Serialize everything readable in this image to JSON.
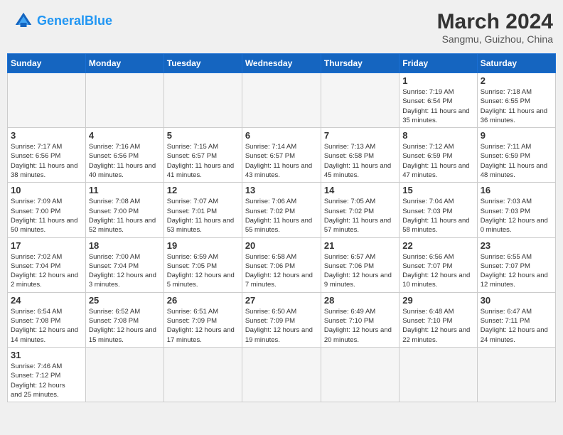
{
  "header": {
    "logo_general": "General",
    "logo_blue": "Blue",
    "month_year": "March 2024",
    "location": "Sangmu, Guizhou, China"
  },
  "weekdays": [
    "Sunday",
    "Monday",
    "Tuesday",
    "Wednesday",
    "Thursday",
    "Friday",
    "Saturday"
  ],
  "weeks": [
    [
      {
        "day": "",
        "info": ""
      },
      {
        "day": "",
        "info": ""
      },
      {
        "day": "",
        "info": ""
      },
      {
        "day": "",
        "info": ""
      },
      {
        "day": "",
        "info": ""
      },
      {
        "day": "1",
        "info": "Sunrise: 7:19 AM\nSunset: 6:54 PM\nDaylight: 11 hours and 35 minutes."
      },
      {
        "day": "2",
        "info": "Sunrise: 7:18 AM\nSunset: 6:55 PM\nDaylight: 11 hours and 36 minutes."
      }
    ],
    [
      {
        "day": "3",
        "info": "Sunrise: 7:17 AM\nSunset: 6:56 PM\nDaylight: 11 hours and 38 minutes."
      },
      {
        "day": "4",
        "info": "Sunrise: 7:16 AM\nSunset: 6:56 PM\nDaylight: 11 hours and 40 minutes."
      },
      {
        "day": "5",
        "info": "Sunrise: 7:15 AM\nSunset: 6:57 PM\nDaylight: 11 hours and 41 minutes."
      },
      {
        "day": "6",
        "info": "Sunrise: 7:14 AM\nSunset: 6:57 PM\nDaylight: 11 hours and 43 minutes."
      },
      {
        "day": "7",
        "info": "Sunrise: 7:13 AM\nSunset: 6:58 PM\nDaylight: 11 hours and 45 minutes."
      },
      {
        "day": "8",
        "info": "Sunrise: 7:12 AM\nSunset: 6:59 PM\nDaylight: 11 hours and 47 minutes."
      },
      {
        "day": "9",
        "info": "Sunrise: 7:11 AM\nSunset: 6:59 PM\nDaylight: 11 hours and 48 minutes."
      }
    ],
    [
      {
        "day": "10",
        "info": "Sunrise: 7:09 AM\nSunset: 7:00 PM\nDaylight: 11 hours and 50 minutes."
      },
      {
        "day": "11",
        "info": "Sunrise: 7:08 AM\nSunset: 7:00 PM\nDaylight: 11 hours and 52 minutes."
      },
      {
        "day": "12",
        "info": "Sunrise: 7:07 AM\nSunset: 7:01 PM\nDaylight: 11 hours and 53 minutes."
      },
      {
        "day": "13",
        "info": "Sunrise: 7:06 AM\nSunset: 7:02 PM\nDaylight: 11 hours and 55 minutes."
      },
      {
        "day": "14",
        "info": "Sunrise: 7:05 AM\nSunset: 7:02 PM\nDaylight: 11 hours and 57 minutes."
      },
      {
        "day": "15",
        "info": "Sunrise: 7:04 AM\nSunset: 7:03 PM\nDaylight: 11 hours and 58 minutes."
      },
      {
        "day": "16",
        "info": "Sunrise: 7:03 AM\nSunset: 7:03 PM\nDaylight: 12 hours and 0 minutes."
      }
    ],
    [
      {
        "day": "17",
        "info": "Sunrise: 7:02 AM\nSunset: 7:04 PM\nDaylight: 12 hours and 2 minutes."
      },
      {
        "day": "18",
        "info": "Sunrise: 7:00 AM\nSunset: 7:04 PM\nDaylight: 12 hours and 3 minutes."
      },
      {
        "day": "19",
        "info": "Sunrise: 6:59 AM\nSunset: 7:05 PM\nDaylight: 12 hours and 5 minutes."
      },
      {
        "day": "20",
        "info": "Sunrise: 6:58 AM\nSunset: 7:06 PM\nDaylight: 12 hours and 7 minutes."
      },
      {
        "day": "21",
        "info": "Sunrise: 6:57 AM\nSunset: 7:06 PM\nDaylight: 12 hours and 9 minutes."
      },
      {
        "day": "22",
        "info": "Sunrise: 6:56 AM\nSunset: 7:07 PM\nDaylight: 12 hours and 10 minutes."
      },
      {
        "day": "23",
        "info": "Sunrise: 6:55 AM\nSunset: 7:07 PM\nDaylight: 12 hours and 12 minutes."
      }
    ],
    [
      {
        "day": "24",
        "info": "Sunrise: 6:54 AM\nSunset: 7:08 PM\nDaylight: 12 hours and 14 minutes."
      },
      {
        "day": "25",
        "info": "Sunrise: 6:52 AM\nSunset: 7:08 PM\nDaylight: 12 hours and 15 minutes."
      },
      {
        "day": "26",
        "info": "Sunrise: 6:51 AM\nSunset: 7:09 PM\nDaylight: 12 hours and 17 minutes."
      },
      {
        "day": "27",
        "info": "Sunrise: 6:50 AM\nSunset: 7:09 PM\nDaylight: 12 hours and 19 minutes."
      },
      {
        "day": "28",
        "info": "Sunrise: 6:49 AM\nSunset: 7:10 PM\nDaylight: 12 hours and 20 minutes."
      },
      {
        "day": "29",
        "info": "Sunrise: 6:48 AM\nSunset: 7:10 PM\nDaylight: 12 hours and 22 minutes."
      },
      {
        "day": "30",
        "info": "Sunrise: 6:47 AM\nSunset: 7:11 PM\nDaylight: 12 hours and 24 minutes."
      }
    ],
    [
      {
        "day": "31",
        "info": "Sunrise: 7:46 AM\nSunset: 7:12 PM\nDaylight: 12 hours and 25 minutes."
      },
      {
        "day": "",
        "info": ""
      },
      {
        "day": "",
        "info": ""
      },
      {
        "day": "",
        "info": ""
      },
      {
        "day": "",
        "info": ""
      },
      {
        "day": "",
        "info": ""
      },
      {
        "day": "",
        "info": ""
      }
    ]
  ]
}
